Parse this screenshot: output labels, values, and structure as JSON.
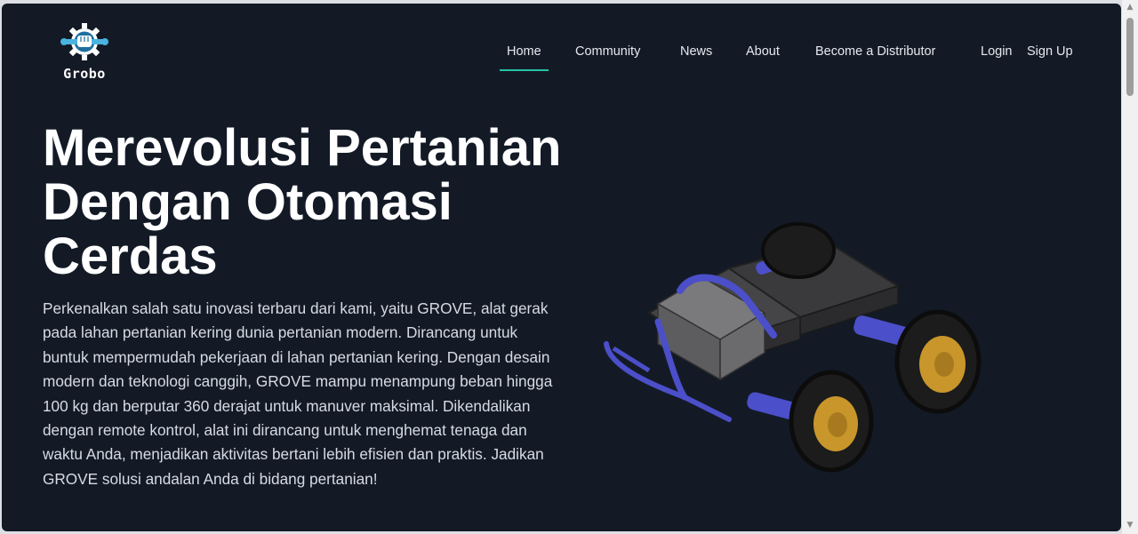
{
  "brand": {
    "name": "Grobo",
    "icon": "gear-fist-wrench-logo"
  },
  "nav": {
    "items": [
      {
        "label": "Home",
        "active": true
      },
      {
        "label": "Community",
        "active": false
      },
      {
        "label": "News",
        "active": false
      },
      {
        "label": "About",
        "active": false
      },
      {
        "label": "Become a Distributor",
        "active": false
      }
    ],
    "login_label": "Login",
    "signup_label": "Sign Up",
    "active_underline_color": "#23c3a6"
  },
  "hero": {
    "title": "Merevolusi Pertanian Dengan Otomasi Cerdas",
    "description": "Perkenalkan salah satu inovasi terbaru dari kami, yaitu GROVE, alat gerak pada lahan pertanian kering dunia pertanian modern. Dirancang untuk buntuk mempermudah pekerjaan di lahan pertanian kering. Dengan desain modern dan teknologi canggih, GROVE mampu menampung beban hingga 100 kg dan berputar 360 derajat untuk manuver maksimal. Dikendalikan dengan remote kontrol, alat ini dirancang untuk menghemat tenaga dan waktu Anda, menjadikan aktivitas bertani lebih efisien dan praktis. Jadikan GROVE solusi andalan Anda di bidang pertanian!",
    "image": "grove-robot-vehicle"
  },
  "colors": {
    "background": "#131a26",
    "accent": "#23c3a6",
    "text": "#ffffff"
  }
}
